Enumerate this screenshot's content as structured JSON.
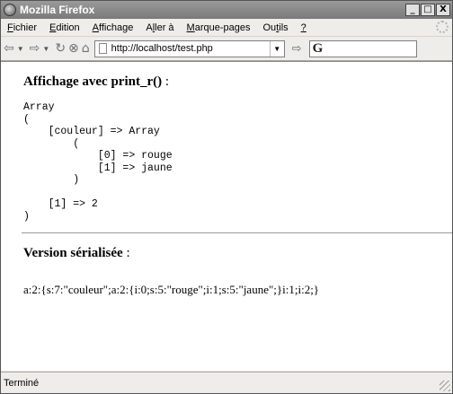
{
  "window": {
    "title": "Mozilla Firefox"
  },
  "window_controls": {
    "minimize": "_",
    "maximize": "□",
    "close": "X"
  },
  "menu": [
    {
      "label": "Fichier",
      "u": "F",
      "rest": "ichier"
    },
    {
      "label": "Edition",
      "u": "E",
      "rest": "dition"
    },
    {
      "label": "Affichage",
      "u": "A",
      "rest": "ffichage"
    },
    {
      "label": "Aller à",
      "pre": "A",
      "u": "l",
      "rest": "ler à"
    },
    {
      "label": "Marque-pages",
      "u": "M",
      "rest": "arque-pages"
    },
    {
      "label": "Outils",
      "pre": "Ou",
      "u": "t",
      "rest": "ils"
    },
    {
      "label": "?",
      "u": "?",
      "rest": ""
    }
  ],
  "toolbar": {
    "back_icon": "back-arrow-icon",
    "forward_icon": "forward-arrow-icon",
    "url": "http://localhost/test.php",
    "search_placeholder": ""
  },
  "content": {
    "heading1_bold": "Affichage avec print_r()",
    "heading1_colon": " :",
    "print_r_output": "Array\n(\n    [couleur] => Array\n        (\n            [0] => rouge\n            [1] => jaune\n        )\n\n    [1] => 2\n)",
    "heading2_bold": "Version sérialisée",
    "heading2_colon": " :",
    "serialized": "a:2:{s:7:\"couleur\";a:2:{i:0;s:5:\"rouge\";i:1;s:5:\"jaune\";}i:1;i:2;}"
  },
  "status": {
    "text": "Terminé"
  }
}
